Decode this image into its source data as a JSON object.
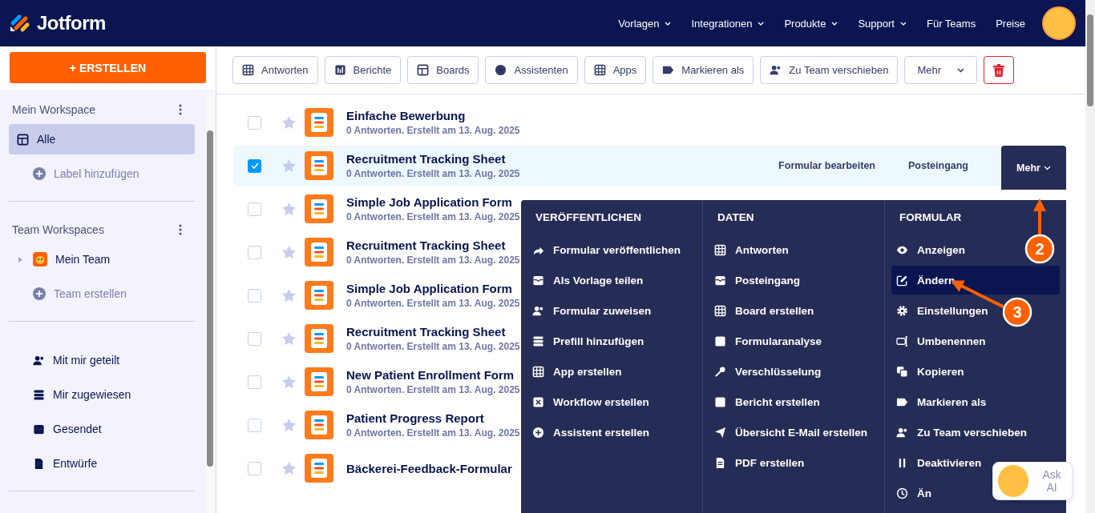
{
  "header": {
    "brand": "Jotform",
    "nav": [
      {
        "label": "Vorlagen",
        "dropdown": true
      },
      {
        "label": "Integrationen",
        "dropdown": true
      },
      {
        "label": "Produkte",
        "dropdown": true
      },
      {
        "label": "Support",
        "dropdown": true
      },
      {
        "label": "Für Teams",
        "dropdown": false
      },
      {
        "label": "Preise",
        "dropdown": false
      }
    ]
  },
  "sidebar": {
    "create_button": "+ ERSTELLEN",
    "sections": [
      {
        "title": "Mein Workspace",
        "items": [
          {
            "label": "Alle",
            "kind": "nav",
            "selected": true
          },
          {
            "label": "Label hinzufügen",
            "kind": "add",
            "selected": false
          }
        ]
      },
      {
        "title": "Team Workspaces",
        "items": [
          {
            "label": "Mein Team",
            "kind": "team",
            "selected": false
          },
          {
            "label": "Team erstellen",
            "kind": "add",
            "selected": false
          }
        ]
      },
      {
        "items": [
          {
            "label": "Mit mir geteilt",
            "kind": "nav",
            "selected": false
          },
          {
            "label": "Mir zugewiesen",
            "kind": "nav",
            "selected": false
          },
          {
            "label": "Gesendet",
            "kind": "nav",
            "selected": false
          },
          {
            "label": "Entwürfe",
            "kind": "nav",
            "selected": false
          }
        ]
      }
    ]
  },
  "toolbar": {
    "buttons": [
      "Antworten",
      "Berichte",
      "Boards",
      "Assistenten",
      "Apps",
      "Markieren als",
      "Zu Team verschieben"
    ],
    "more": "Mehr"
  },
  "forms": [
    {
      "title": "Einfache Bewerbung",
      "meta": "0 Antworten. Erstellt am 13. Aug. 2025",
      "checked": false,
      "selected": false
    },
    {
      "title": "Recruitment Tracking Sheet",
      "meta": "0 Antworten. Erstellt am 13. Aug. 2025",
      "checked": true,
      "selected": true
    },
    {
      "title": "Simple Job Application Form",
      "meta": "0 Antworten. Erstellt am 13. Aug. 2025",
      "checked": false,
      "selected": false
    },
    {
      "title": "Recruitment Tracking Sheet",
      "meta": "0 Antworten. Erstellt am 13. Aug. 2025",
      "checked": false,
      "selected": false
    },
    {
      "title": "Simple Job Application Form",
      "meta": "0 Antworten. Erstellt am 13. Aug. 2025",
      "checked": false,
      "selected": false
    },
    {
      "title": "Recruitment Tracking Sheet",
      "meta": "0 Antworten. Erstellt am 13. Aug. 2025",
      "checked": false,
      "selected": false
    },
    {
      "title": "New Patient Enrollment Form",
      "meta": "0 Antworten. Erstellt am 13. Aug. 2025",
      "checked": false,
      "selected": false
    },
    {
      "title": "Patient Progress Report",
      "meta": "0 Antworten. Erstellt am 13. Aug. 2025",
      "checked": false,
      "selected": false
    },
    {
      "title": "Bäckerei-Feedback-Formular",
      "checked": false,
      "selected": false
    }
  ],
  "row_actions": {
    "edit": "Formular bearbeiten",
    "inbox": "Posteingang",
    "more": "Mehr"
  },
  "menu": {
    "columns": [
      {
        "title": "VERÖFFENTLICHEN",
        "items": [
          {
            "label": "Formular veröffentlichen",
            "selected": false
          },
          {
            "label": "Als Vorlage teilen",
            "selected": false
          },
          {
            "label": "Formular zuweisen",
            "selected": false
          },
          {
            "label": "Prefill hinzufügen",
            "selected": false
          },
          {
            "label": "App erstellen",
            "selected": false
          },
          {
            "label": "Workflow erstellen",
            "selected": false
          },
          {
            "label": "Assistent erstellen",
            "selected": false
          }
        ]
      },
      {
        "title": "DATEN",
        "items": [
          {
            "label": "Antworten",
            "selected": false
          },
          {
            "label": "Posteingang",
            "selected": false
          },
          {
            "label": "Board erstellen",
            "selected": false
          },
          {
            "label": "Formularanalyse",
            "selected": false
          },
          {
            "label": "Verschlüsselung",
            "selected": false
          },
          {
            "label": "Bericht erstellen",
            "selected": false
          },
          {
            "label": "Übersicht E-Mail erstellen",
            "selected": false
          },
          {
            "label": "PDF erstellen",
            "selected": false
          }
        ]
      },
      {
        "title": "FORMULAR",
        "items": [
          {
            "label": "Anzeigen",
            "selected": false
          },
          {
            "label": "Ändern",
            "selected": true
          },
          {
            "label": "Einstellungen",
            "selected": false
          },
          {
            "label": "Umbenennen",
            "selected": false
          },
          {
            "label": "Kopieren",
            "selected": false
          },
          {
            "label": "Markieren als",
            "selected": false
          },
          {
            "label": "Zu Team verschieben",
            "selected": false
          },
          {
            "label": "Deaktivieren",
            "selected": false
          },
          {
            "label": "Än",
            "selected": false
          }
        ]
      }
    ]
  },
  "ask_ai": {
    "label": "Ask AI"
  },
  "annotations": [
    {
      "number": "2"
    },
    {
      "number": "3"
    }
  ]
}
